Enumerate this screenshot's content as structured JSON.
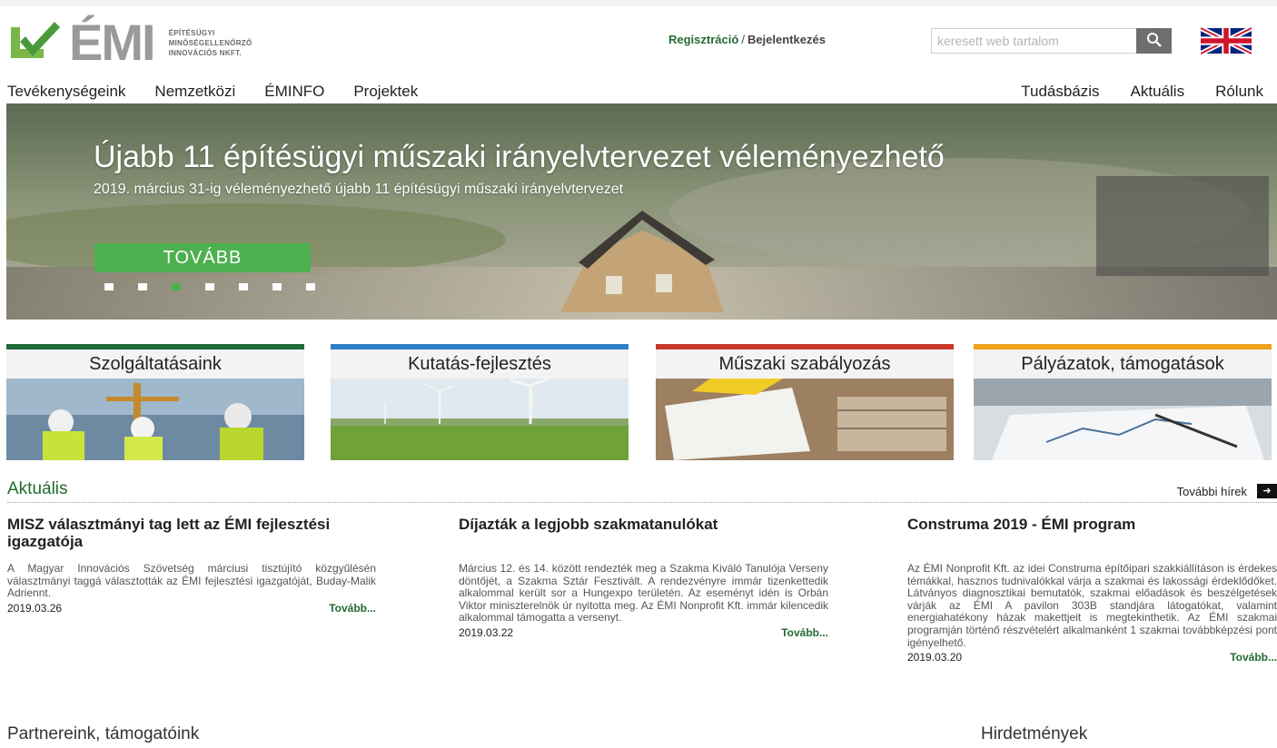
{
  "header": {
    "logo_text": "ÉMI",
    "logo_tagline": [
      "ÉPÍTÉSÜGYI",
      "MINŐSÉGELLENŐRZŐ",
      "INNOVÁCIÓS NKFT."
    ],
    "auth": {
      "register": "Regisztráció",
      "separator": "/",
      "login": "Bejelentkezés"
    },
    "search": {
      "placeholder": "keresett web tartalom",
      "button_icon": "search-icon"
    },
    "language_flag": "uk-flag-icon"
  },
  "nav": {
    "left": [
      "Tevékenységeink",
      "Nemzetközi",
      "ÉMINFO",
      "Projektek"
    ],
    "right": [
      "Tudásbázis",
      "Aktuális",
      "Rólunk"
    ]
  },
  "hero": {
    "title": "Újabb 11 építésügyi műszaki irányelvtervezet véleményezhető",
    "subtitle": "2019. március 31-ig véleményezhető újabb 11 építésügyi műszaki irányelvtervezet",
    "button": "TOVÁBB",
    "slide_count": 7,
    "active_slide": 3
  },
  "categories": [
    {
      "title": "Szolgáltatásaink",
      "color": "#1f6b3a"
    },
    {
      "title": "Kutatás-fejlesztés",
      "color": "#2e7fc7"
    },
    {
      "title": "Műszaki szabályozás",
      "color": "#c9392a"
    },
    {
      "title": "Pályázatok, támogatások",
      "color": "#f0a21e"
    }
  ],
  "news": {
    "heading": "Aktuális",
    "more_label": "További hírek",
    "articles": [
      {
        "title": "MISZ választmányi tag lett az ÉMI fejlesztési igazgatója",
        "text": "A Magyar Innovációs Szövetség márciusi tisztújító közgyűlésén választmányi taggá választották az ÉMI fejlesztési igazgatóját, Buday-Malik Adriennt.",
        "date": "2019.03.26",
        "more": "Tovább..."
      },
      {
        "title": "Díjazták a legjobb szakmatanulókat",
        "text": "Március 12. és 14. között rendezték meg a Szakma Kiváló Tanulója Verseny döntőjét, a Szakma Sztár Fesztivált. A rendezvényre immár tizenkettedik alkalommal került sor a Hungexpo területén. Az eseményt idén is Orbán Viktor miniszterelnök úr nyitotta meg. Az ÉMI Nonprofit Kft. immár kilencedik alkalommal támogatta a versenyt.",
        "date": "2019.03.22",
        "more": "Tovább..."
      },
      {
        "title": "Construma 2019 - ÉMI program",
        "text": "Az ÉMI Nonprofit Kft. az idei Construma építőipari szakkiállításon is érdekes témákkal, hasznos tudnivalókkal várja a szakmai és lakossági érdeklődőket. Látványos diagnosztikai bemutatók, szakmai előadások és beszélgetések várják az ÉMI A pavilon 303B standjára látogatókat, valamint energiahatékony házak makettjeit is megtekinthetik. Az ÉMI szakmai programján történő részvételért alkalmanként 1 szakmai továbbképzési pont igényelhető.",
        "date": "2019.03.20",
        "more": "Tovább..."
      }
    ]
  },
  "sections": {
    "partners": "Partnereink, támogatóink",
    "notices": "Hirdetmények"
  }
}
